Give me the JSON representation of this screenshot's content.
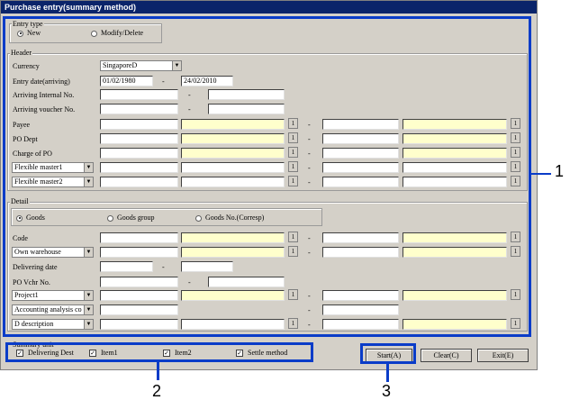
{
  "window": {
    "title": "Purchase entry(summary method)"
  },
  "entry_type": {
    "label": "Entry type",
    "options": [
      {
        "label": "New",
        "selected": true
      },
      {
        "label": "Modify/Delete",
        "selected": false
      }
    ]
  },
  "header": {
    "label": "Header",
    "currency": {
      "label": "Currency",
      "value": "SingaporeD"
    },
    "entry_date": {
      "label": "Entry date(arriving)",
      "from": "01/02/1980",
      "to": "24/02/2010"
    },
    "internal_no_label": "Arriving Internal No.",
    "voucher_no_label": "Arriving voucher No.",
    "payee_label": "Payee",
    "po_dept_label": "PO Dept",
    "charge_label": "Charge of PO",
    "flex1": "Flexible master1",
    "flex2": "Flexible master2"
  },
  "detail": {
    "label": "Detail",
    "radios": [
      {
        "label": "Goods",
        "selected": true
      },
      {
        "label": "Goods group",
        "selected": false
      },
      {
        "label": "Goods No.(Corresp)",
        "selected": false
      }
    ],
    "code_label": "Code",
    "warehouse": "Own warehouse",
    "delivering_date_label": "Delivering date",
    "po_vchr_label": "PO Vchr No.",
    "project": "Project1",
    "accounting": "Accounting analysis co",
    "description": "D description"
  },
  "summary_unit": {
    "label": "Summary unit",
    "items": [
      {
        "label": "Delivering Dest",
        "checked": true
      },
      {
        "label": "Item1",
        "checked": true
      },
      {
        "label": "Item2",
        "checked": true
      },
      {
        "label": "Settle method",
        "checked": true
      }
    ]
  },
  "buttons": {
    "start": "Start(A)",
    "clear": "Clear(C)",
    "exit": "Exit(E)"
  },
  "icons": {
    "lookup": "1",
    "dash": "-",
    "arrow": "▼"
  },
  "callouts": {
    "one": "1",
    "two": "2",
    "three": "3"
  },
  "colors": {
    "highlight": "#0a3cc8",
    "title_bar": "#0a246a",
    "required_field": "#ffffcc"
  }
}
